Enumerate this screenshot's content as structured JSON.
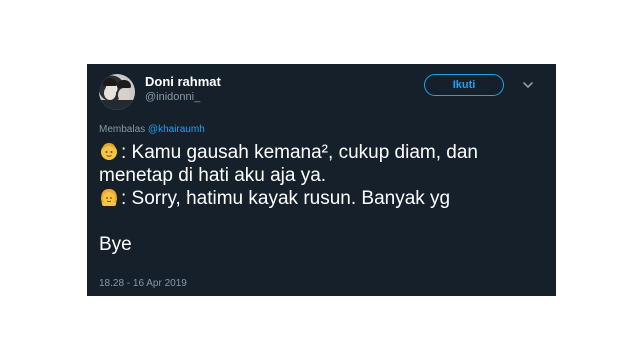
{
  "tweet": {
    "author": {
      "name": "Doni rahmat",
      "handle": "@inidonni_"
    },
    "follow_label": "Ikuti",
    "replying": {
      "prefix": "Membalas",
      "mention": "@khairaumh"
    },
    "lines": {
      "line1": ": Kamu gausah kemana², cukup diam, dan",
      "line2": "menetap di hati aku aja ya.",
      "line3": ": Sorry, hatimu kayak rusun. Banyak yg",
      "line4": "Bye"
    },
    "emoji": {
      "first": "person-emoji-icon",
      "second": "girl-emoji-icon"
    },
    "timestamp": "18.28 - 16 Apr 2019"
  },
  "colors": {
    "background": "#15202b",
    "accent": "#1da1f2",
    "muted": "#8899a6",
    "text": "#ffffff"
  }
}
